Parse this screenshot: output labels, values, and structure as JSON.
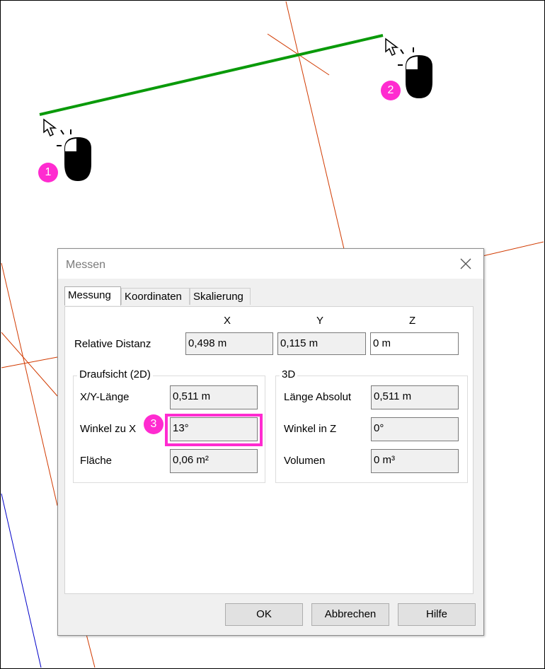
{
  "badges": {
    "one": "1",
    "two": "2",
    "three": "3"
  },
  "dialog": {
    "title": "Messen",
    "tabs": [
      "Messung",
      "Koordinaten",
      "Skalierung"
    ],
    "columns": {
      "x": "X",
      "y": "Y",
      "z": "Z"
    },
    "relative": {
      "label": "Relative Distanz",
      "x": "0,498 m",
      "y": "0,115 m",
      "z": "0 m"
    },
    "plan": {
      "title": "Draufsicht (2D)",
      "xy_label": "X/Y-Länge",
      "xy_value": "0,511 m",
      "angle_label": "Winkel zu X",
      "angle_value": "13°",
      "area_label": "Fläche",
      "area_value": "0,06 m²"
    },
    "threed": {
      "title": "3D",
      "length_label": "Länge Absolut",
      "length_value": "0,511 m",
      "angle_label": "Winkel in Z",
      "angle_value": "0°",
      "volume_label": "Volumen",
      "volume_value": "0 m³"
    },
    "buttons": {
      "ok": "OK",
      "cancel": "Abbrechen",
      "help": "Hilfe"
    }
  },
  "colors": {
    "measure_line": "#0a9a0a",
    "grid_lines": "#d13a00",
    "axis_blue": "#0000c8",
    "highlight": "#ff2bd0"
  }
}
